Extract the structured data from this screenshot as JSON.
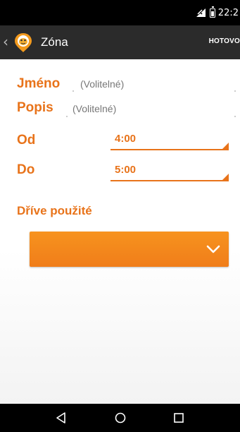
{
  "status_bar": {
    "time": "22:2",
    "icons": [
      "signal-icon",
      "battery-icon"
    ]
  },
  "app_bar": {
    "back_icon": "chevron-left-icon",
    "logo_icon": "app-logo-icon",
    "title": "Zóna",
    "done_label": "HOTOVO"
  },
  "form": {
    "name": {
      "label": "Jméno",
      "hint": "(Volitelné)"
    },
    "description": {
      "label": "Popis",
      "hint": "(Volitelné)"
    },
    "from": {
      "label": "Od",
      "value": "4:00"
    },
    "to": {
      "label": "Do",
      "value": "5:00"
    },
    "previously_used": {
      "label": "Dříve použité",
      "icon": "chevron-down-icon"
    }
  },
  "nav_bar": {
    "icons": [
      "back-triangle-icon",
      "home-circle-icon",
      "recents-square-icon"
    ]
  },
  "colors": {
    "accent": "#e8731a",
    "button": "#f58a1f",
    "app_bar": "#2b2b2b",
    "status_bar": "#000000"
  }
}
